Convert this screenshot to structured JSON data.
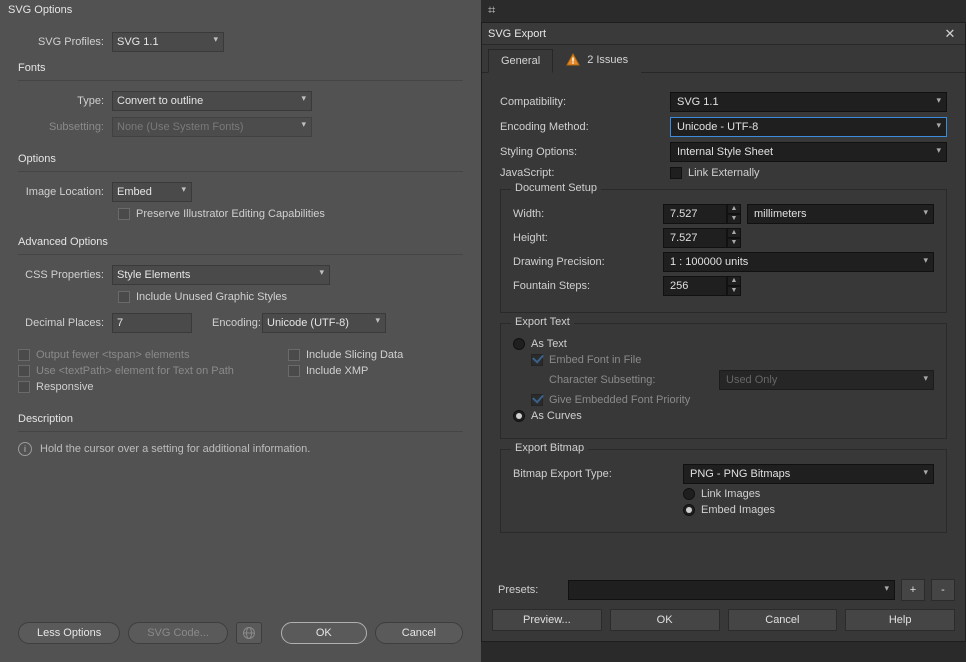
{
  "left": {
    "title": "SVG Options",
    "profiles_label": "SVG Profiles:",
    "profiles_value": "SVG 1.1",
    "fonts_header": "Fonts",
    "type_label": "Type:",
    "type_value": "Convert to outline",
    "subsetting_label": "Subsetting:",
    "subsetting_value": "None (Use System Fonts)",
    "options_header": "Options",
    "image_loc_label": "Image Location:",
    "image_loc_value": "Embed",
    "preserve_label": "Preserve Illustrator Editing Capabilities",
    "advanced_header": "Advanced Options",
    "css_label": "CSS Properties:",
    "css_value": "Style Elements",
    "unused_styles_label": "Include Unused Graphic Styles",
    "decimal_label": "Decimal Places:",
    "decimal_value": "7",
    "encoding_label": "Encoding:",
    "encoding_value": "Unicode (UTF-8)",
    "output_tspan_label": "Output fewer <tspan> elements",
    "slicing_label": "Include Slicing Data",
    "textpath_label": "Use <textPath> element for Text on Path",
    "xmp_label": "Include XMP",
    "responsive_label": "Responsive",
    "desc_header": "Description",
    "desc_text": "Hold the cursor over a setting for additional information.",
    "less_options": "Less Options",
    "svg_code": "SVG Code...",
    "ok": "OK",
    "cancel": "Cancel"
  },
  "right": {
    "title": "SVG Export",
    "tab_general": "General",
    "tab_issues": "2 Issues",
    "compat_label": "Compatibility:",
    "compat_value": "SVG 1.1",
    "enc_label": "Encoding Method:",
    "enc_value": "Unicode - UTF-8",
    "style_label": "Styling Options:",
    "style_value": "Internal Style Sheet",
    "js_label": "JavaScript:",
    "js_link_label": "Link Externally",
    "doc_setup": "Document Setup",
    "width_label": "Width:",
    "width_value": "7.527",
    "height_label": "Height:",
    "height_value": "7.527",
    "units_value": "millimeters",
    "precision_label": "Drawing Precision:",
    "precision_value": "1 : 100000 units",
    "fountain_label": "Fountain Steps:",
    "fountain_value": "256",
    "export_text": "Export Text",
    "as_text": "As Text",
    "embed_font": "Embed Font in File",
    "char_subset_label": "Character Subsetting:",
    "char_subset_value": "Used Only",
    "give_priority": "Give Embedded Font Priority",
    "as_curves": "As Curves",
    "export_bitmap": "Export Bitmap",
    "bitmap_type_label": "Bitmap Export Type:",
    "bitmap_type_value": "PNG - PNG Bitmaps",
    "link_images": "Link Images",
    "embed_images": "Embed Images",
    "presets_label": "Presets:",
    "preview": "Preview...",
    "ok": "OK",
    "cancel": "Cancel",
    "help": "Help"
  }
}
